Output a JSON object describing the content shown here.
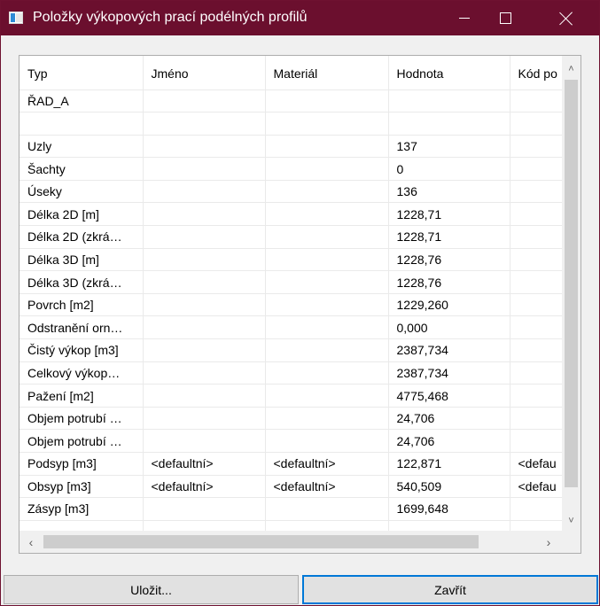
{
  "window": {
    "title": "Položky výkopových prací podélných profilů"
  },
  "grid": {
    "columns": [
      "Typ",
      "Jméno",
      "Materiál",
      "Hodnota",
      "Kód po"
    ],
    "rows": [
      [
        "ŘAD_A",
        "",
        "",
        "",
        ""
      ],
      [
        "",
        "",
        "",
        "",
        ""
      ],
      [
        "Uzly",
        "",
        "",
        "137",
        ""
      ],
      [
        "Šachty",
        "",
        "",
        "0",
        ""
      ],
      [
        "Úseky",
        "",
        "",
        "136",
        ""
      ],
      [
        "Délka 2D [m]",
        "",
        "",
        "1228,71",
        ""
      ],
      [
        "Délka 2D (zkrá…",
        "",
        "",
        "1228,71",
        ""
      ],
      [
        "Délka 3D [m]",
        "",
        "",
        "1228,76",
        ""
      ],
      [
        "Délka 3D (zkrá…",
        "",
        "",
        "1228,76",
        ""
      ],
      [
        "Povrch [m2]",
        "",
        "",
        "1229,260",
        ""
      ],
      [
        "Odstranění orn…",
        "",
        "",
        "0,000",
        ""
      ],
      [
        "Čistý výkop [m3]",
        "",
        "",
        "2387,734",
        ""
      ],
      [
        "Celkový výkop…",
        "",
        "",
        "2387,734",
        ""
      ],
      [
        "Pažení [m2]",
        "",
        "",
        "4775,468",
        ""
      ],
      [
        "Objem potrubí …",
        "",
        "",
        "24,706",
        ""
      ],
      [
        "Objem potrubí …",
        "",
        "",
        "24,706",
        ""
      ],
      [
        "Podsyp [m3]",
        "<defaultní>",
        "<defaultní>",
        "122,871",
        "<defau"
      ],
      [
        "Obsyp [m3]",
        "<defaultní>",
        "<defaultní>",
        "540,509",
        "<defau"
      ],
      [
        "Zásyp [m3]",
        "",
        "",
        "1699,648",
        ""
      ],
      [
        "",
        "",
        "",
        "",
        ""
      ]
    ]
  },
  "buttons": {
    "save": "Uložit...",
    "close": "Zavřít"
  },
  "colors": {
    "titlebar": "#6b0f2e",
    "focus_border": "#0078d7"
  }
}
